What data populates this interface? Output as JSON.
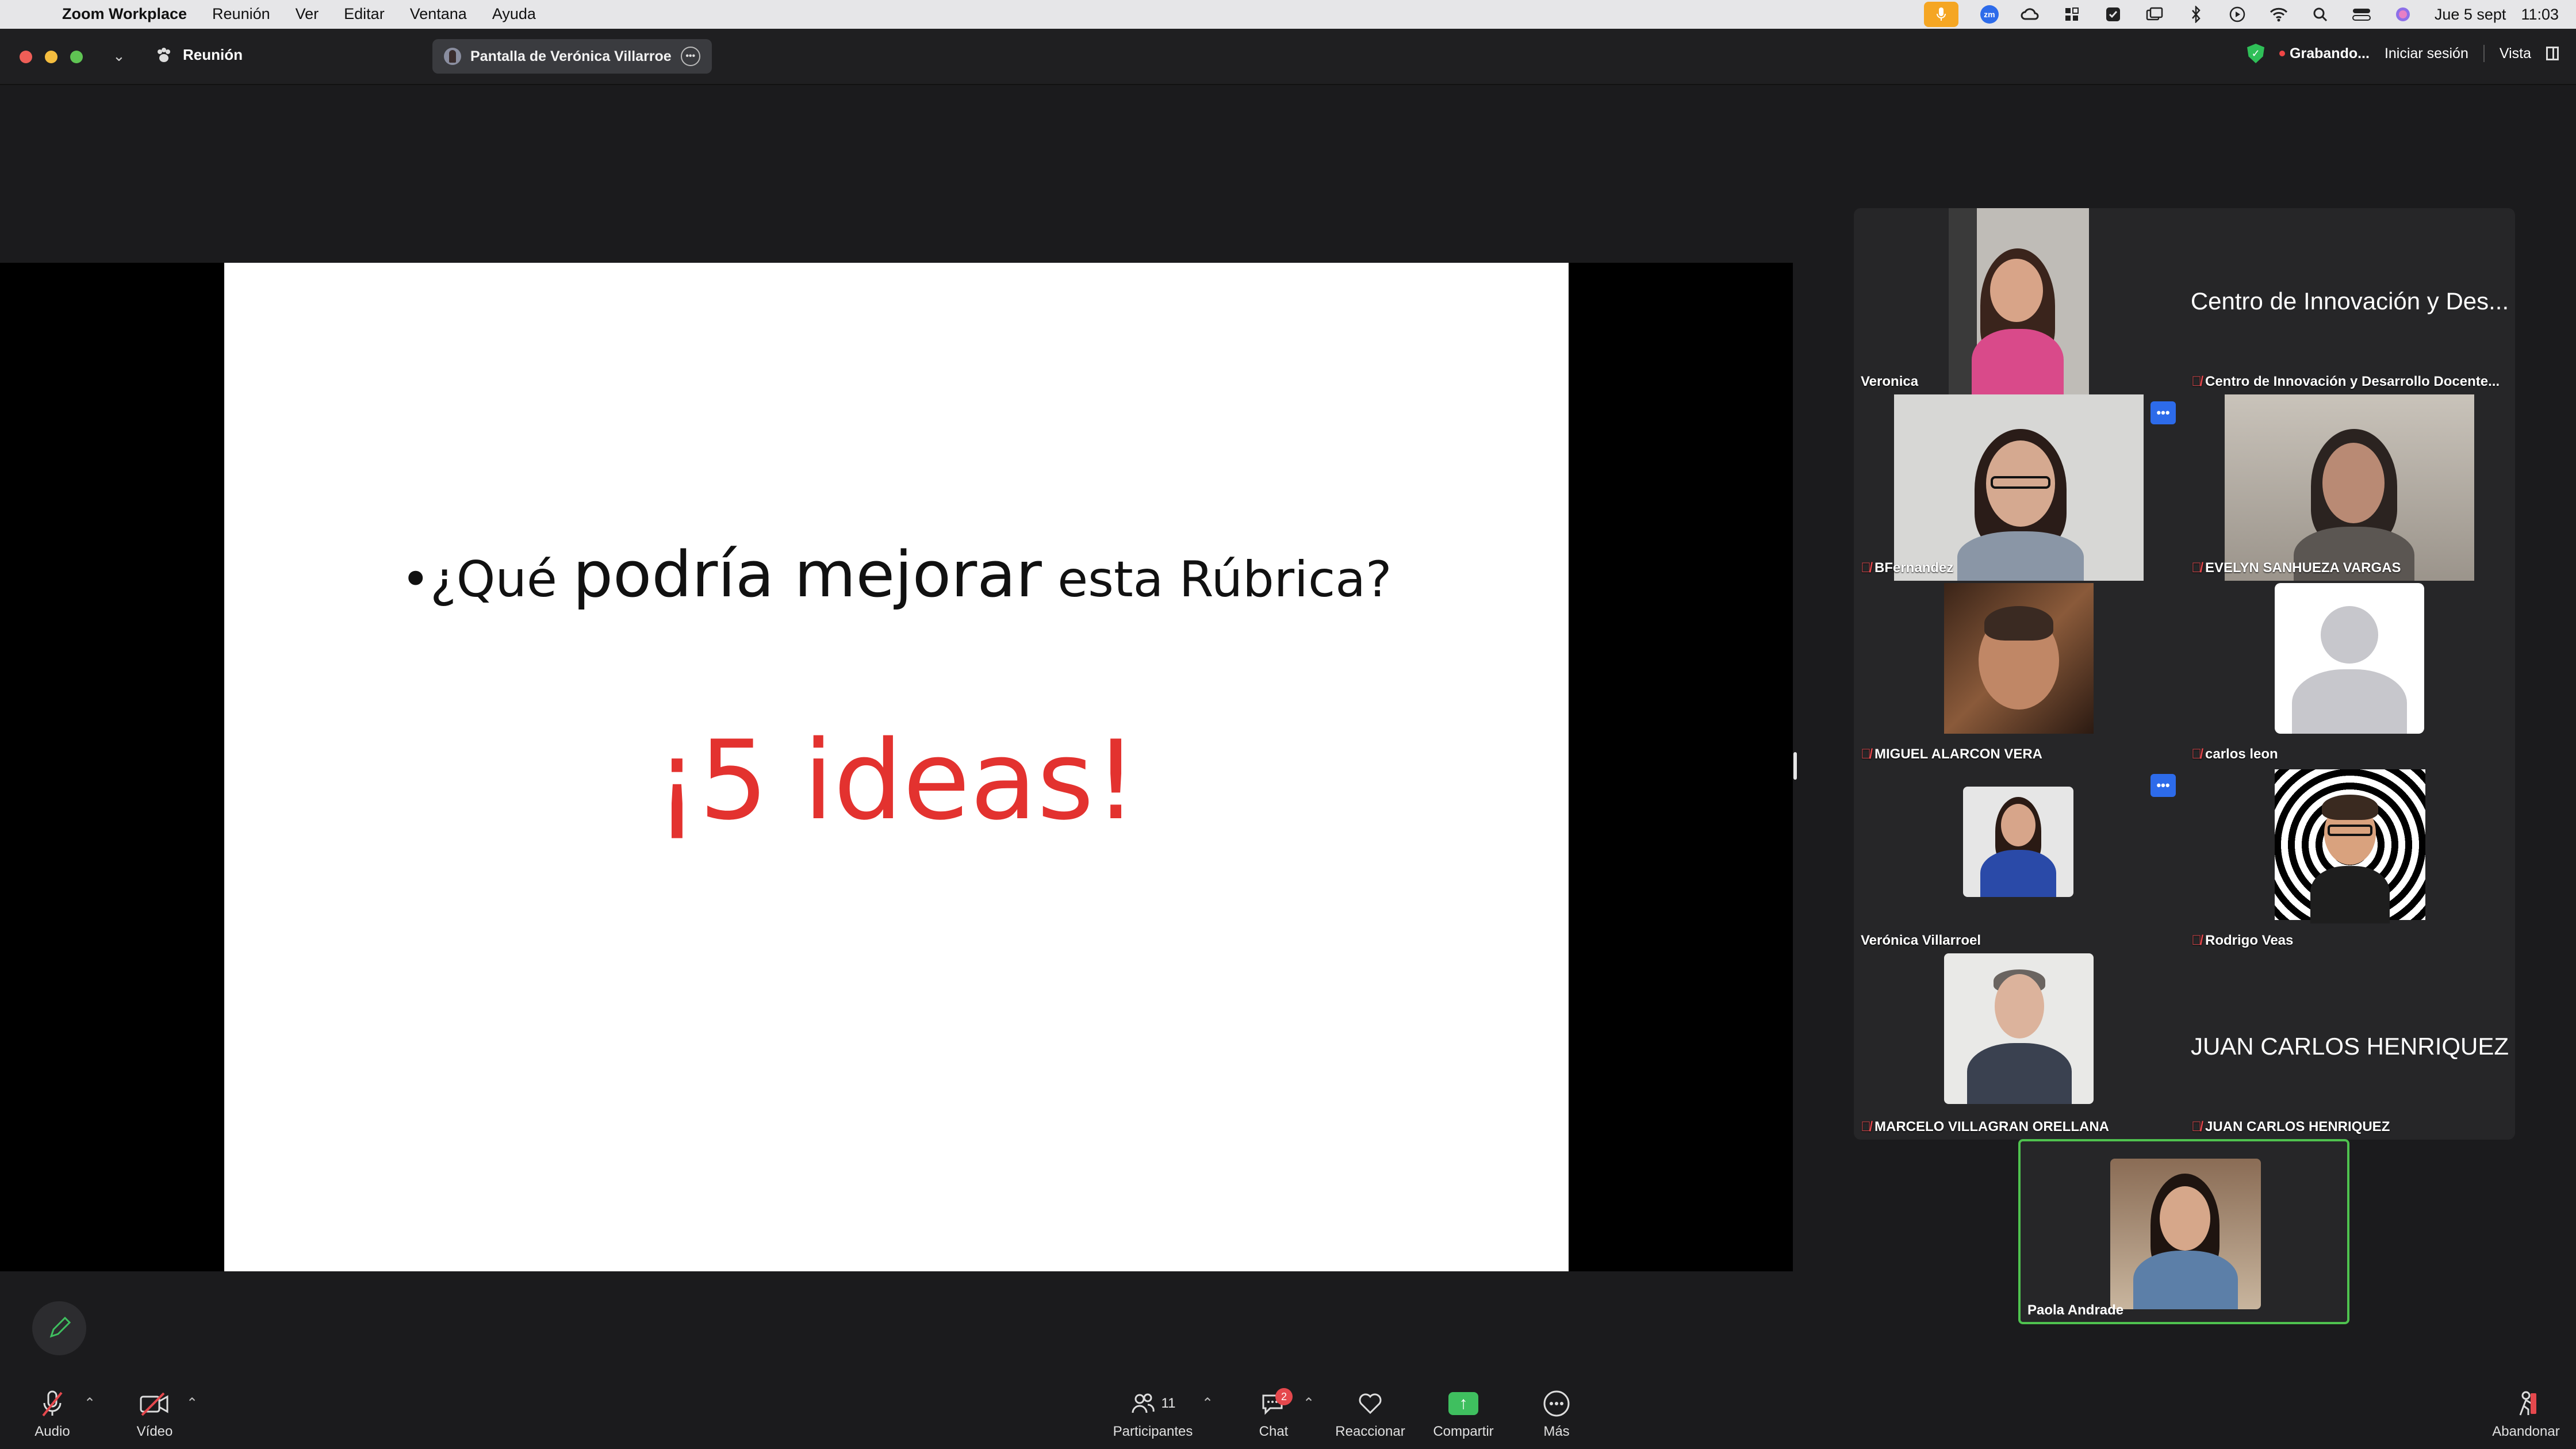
{
  "menubar": {
    "app_name": "Zoom Workplace",
    "menus": [
      "Reunión",
      "Ver",
      "Editar",
      "Ventana",
      "Ayuda"
    ],
    "date": "Jue 5 sept",
    "time": "11:03"
  },
  "titlebar": {
    "meeting_label": "Reunión",
    "share_pill": "Pantalla de Verónica Villarroe",
    "recording": "Grabando...",
    "sign_in": "Iniciar sesión",
    "view": "Vista"
  },
  "slide": {
    "q_part1": "•¿Qué ",
    "q_part2": "podría mejorar",
    "q_part3": " esta Rúbrica?",
    "ideas": "¡5 ideas!"
  },
  "gallery": {
    "veronica": "Veronica",
    "centro_big": "Centro de Innovación y Des...",
    "centro_label": "Centro de Innovación y Desarrollo Docente...",
    "bfernandez": "BFernandez",
    "evelyn": "EVELYN SANHUEZA VARGAS",
    "miguel": "MIGUEL ALARCON VERA",
    "carlos": "carlos leon",
    "veronica_v": "Verónica Villarroel",
    "rodrigo": "Rodrigo Veas",
    "marcelo": "MARCELO VILLAGRAN ORELLANA",
    "juan_big": "JUAN CARLOS HENRIQUEZ",
    "juan_label": "JUAN CARLOS HENRIQUEZ",
    "paola": "Paola Andrade",
    "more_glyph": "•••"
  },
  "toolbar": {
    "audio": "Audio",
    "video": "Vídeo",
    "participants": "Participantes",
    "participants_count": "11",
    "chat": "Chat",
    "chat_badge": "2",
    "react": "Reaccionar",
    "share": "Compartir",
    "more": "Más",
    "leave": "Abandonar"
  },
  "colors": {
    "accent_green": "#3fbf5f",
    "mic_off_red": "#e5484d",
    "ideas_red": "#e3322f",
    "more_blue": "#2d6bea"
  },
  "icons": [
    "apple-icon",
    "microphone-icon",
    "zoom-icon",
    "creative-cloud-icon",
    "grid-icon",
    "shield-icon",
    "window-icon",
    "bluetooth-icon",
    "play-icon",
    "wifi-icon",
    "search-icon",
    "control-center-icon",
    "siri-icon",
    "video-off-icon",
    "participants-icon",
    "chat-icon",
    "heart-icon",
    "share-arrow-icon",
    "more-dots-icon",
    "leave-icon",
    "pencil-icon"
  ]
}
